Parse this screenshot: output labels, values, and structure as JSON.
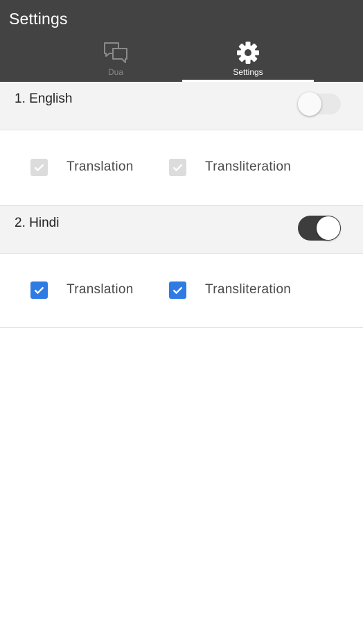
{
  "app_bar": {
    "title": "Settings",
    "tabs": [
      {
        "label": "Dua",
        "icon": "chat-bubbles-icon",
        "selected": false
      },
      {
        "label": "Settings",
        "icon": "gear-icon",
        "selected": true
      }
    ]
  },
  "languages": [
    {
      "title": "1. English",
      "enabled": false,
      "options": [
        {
          "label": "Translation",
          "checked": true,
          "disabled": true
        },
        {
          "label": "Transliteration",
          "checked": true,
          "disabled": true
        }
      ]
    },
    {
      "title": "2. Hindi",
      "enabled": true,
      "options": [
        {
          "label": "Translation",
          "checked": true,
          "disabled": false
        },
        {
          "label": "Transliteration",
          "checked": true,
          "disabled": false
        }
      ]
    }
  ],
  "colors": {
    "app_bar": "#434343",
    "checkbox_checked": "#2f7be4",
    "toggle_on_track": "#3d3d3d"
  }
}
